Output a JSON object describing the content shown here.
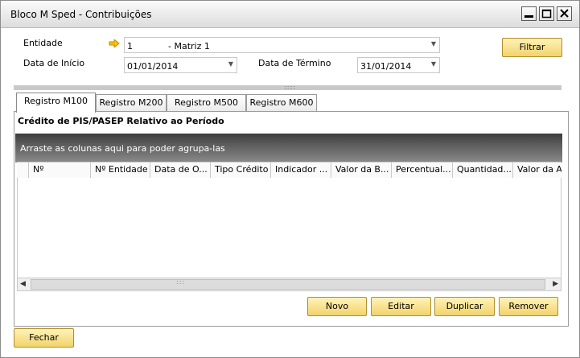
{
  "window": {
    "title": "Bloco M Sped - Contribuições"
  },
  "filters": {
    "entidade_label": "Entidade",
    "entidade_code": "1",
    "entidade_name": "- Matriz 1",
    "data_inicio_label": "Data de Início",
    "data_inicio_value": "01/01/2014",
    "data_termino_label": "Data de Término",
    "data_termino_value": "31/01/2014",
    "filtrar_label": "Filtrar"
  },
  "tabs": [
    {
      "label": "Registro M100",
      "active": true
    },
    {
      "label": "Registro M200",
      "active": false
    },
    {
      "label": "Registro M500",
      "active": false
    },
    {
      "label": "Registro M600",
      "active": false
    }
  ],
  "panel": {
    "title": "Crédito de PIS/PASEP Relativo ao Período",
    "group_hint": "Arraste as colunas aqui para poder agrupa-las"
  },
  "grid": {
    "columns": [
      "Nº",
      "Nº Entidade",
      "Data de O...",
      "Tipo Crédito",
      "Indicador ...",
      "Valor da B...",
      "Percentual...",
      "Quantidad...",
      "Valor da Al..."
    ],
    "rows": []
  },
  "actions": {
    "novo": "Novo",
    "editar": "Editar",
    "duplicar": "Duplicar",
    "remover": "Remover",
    "fechar": "Fechar"
  },
  "colors": {
    "button_gold": "#f2d36b",
    "arrow_yellow": "#f0b400"
  }
}
